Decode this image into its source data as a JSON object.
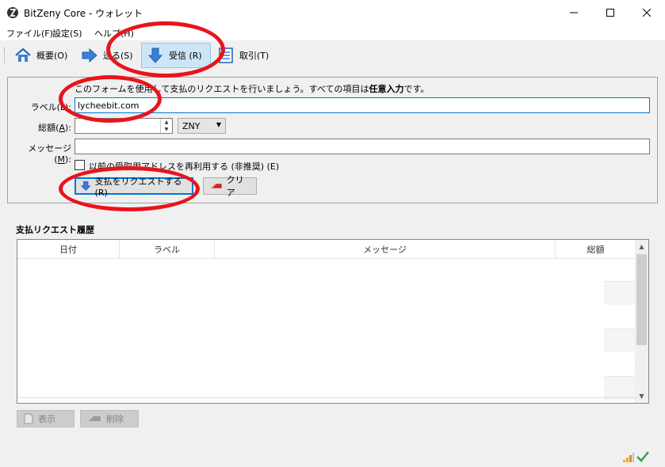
{
  "window": {
    "title": "BitZeny Core - ウォレット",
    "controls": {
      "minimize": "—",
      "maximize": "□",
      "close": "✕"
    }
  },
  "menu": [
    {
      "label": "ファイル(F)",
      "key": "file"
    },
    {
      "label": "設定(S)",
      "key": "settings"
    },
    {
      "label": "ヘルプ(H)",
      "key": "help"
    }
  ],
  "toolbar": {
    "overview": "概要(O)",
    "send": "送る(S)",
    "receive": "受信 (R)",
    "transactions": "取引(T)",
    "active": "receive"
  },
  "form": {
    "intro_prefix": "このフォームを使用して支払のリクエストを行いましょう。すべての項目は",
    "intro_bold": "任意入力",
    "intro_suffix": "です。",
    "label_label": "ラベル(L):",
    "label_value": "lycheebit.com",
    "amount_label_prefix": "総額(",
    "amount_label_key": "A",
    "amount_label_suffix": "):",
    "amount_value": "",
    "unit": "ZNY",
    "message_label_prefix": "メッセージ (",
    "message_label_key": "M",
    "message_label_suffix": "):",
    "message_value": "",
    "reuse_checkbox_label": "以前の受取用アドレスを再利用する (非推奨) (E)",
    "reuse_checked": false,
    "request_button": "支払をリクエストする (R)",
    "clear_button": "クリア"
  },
  "history": {
    "title": "支払リクエスト履歴",
    "columns": [
      "日付",
      "ラベル",
      "メッセージ",
      "総額"
    ],
    "rows": []
  },
  "actions": {
    "show": "表示",
    "remove": "削除"
  },
  "colors": {
    "annotation": "#e8141b",
    "accent": "#0078d7",
    "status_ok": "#2ea44f"
  }
}
